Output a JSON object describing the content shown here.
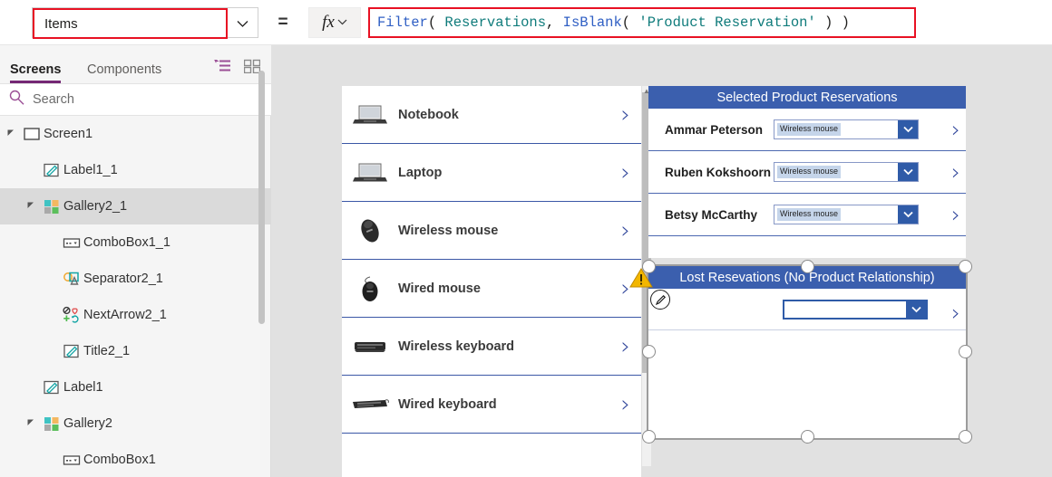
{
  "formula_bar": {
    "property_value": "Items",
    "property_dropdown_icon": "chevron-down-icon",
    "equals": "=",
    "fx_glyph": "fx",
    "fx_chevron_icon": "chevron-down-icon",
    "formula_tokens": [
      {
        "text": "Filter",
        "kind": "fn"
      },
      {
        "text": "( ",
        "kind": "punc"
      },
      {
        "text": "Reservations",
        "kind": "tbl"
      },
      {
        "text": ", ",
        "kind": "punc"
      },
      {
        "text": "IsBlank",
        "kind": "fn"
      },
      {
        "text": "( ",
        "kind": "punc"
      },
      {
        "text": "'Product Reservation'",
        "kind": "str"
      },
      {
        "text": " ) )",
        "kind": "punc"
      }
    ],
    "formula_plain": "Filter( Reservations, IsBlank( 'Product Reservation' ) )",
    "accent_red": "#e81123",
    "fn_color": "#2f5fc4",
    "table_color": "#0f7b7b"
  },
  "sidebar": {
    "tabs": [
      {
        "label": "Screens",
        "active": true
      },
      {
        "label": "Components",
        "active": false
      }
    ],
    "view_icons": [
      {
        "name": "tree-view-icon",
        "color": "#9b4f96"
      },
      {
        "name": "grid-view-icon",
        "color": "#8a8a8a"
      }
    ],
    "search": {
      "placeholder": "Search",
      "value": "",
      "icon": "search-icon"
    },
    "tree": [
      {
        "label": "Screen1",
        "icon": "screen-icon",
        "indent": 0,
        "caret": true,
        "selected": false
      },
      {
        "label": "Label1_1",
        "icon": "label-icon",
        "indent": 1,
        "caret": false,
        "selected": false
      },
      {
        "label": "Gallery2_1",
        "icon": "gallery-icon",
        "indent": 1,
        "caret": true,
        "selected": true
      },
      {
        "label": "ComboBox1_1",
        "icon": "combobox-icon",
        "indent": 2,
        "caret": false,
        "selected": false
      },
      {
        "label": "Separator2_1",
        "icon": "shapes-icon",
        "indent": 2,
        "caret": false,
        "selected": false
      },
      {
        "label": "NextArrow2_1",
        "icon": "icons-icon",
        "indent": 2,
        "caret": false,
        "selected": false
      },
      {
        "label": "Title2_1",
        "icon": "label-icon",
        "indent": 2,
        "caret": false,
        "selected": false
      },
      {
        "label": "Label1",
        "icon": "label-icon",
        "indent": 1,
        "caret": false,
        "selected": false
      },
      {
        "label": "Gallery2",
        "icon": "gallery-icon",
        "indent": 1,
        "caret": true,
        "selected": false
      },
      {
        "label": "ComboBox1",
        "icon": "combobox-icon",
        "indent": 2,
        "caret": false,
        "selected": false
      }
    ]
  },
  "canvas": {
    "product_gallery": {
      "name": "product-gallery",
      "items": [
        {
          "label": "Notebook",
          "thumb": "notebook-photo",
          "chevron": "chevron-right-icon"
        },
        {
          "label": "Laptop",
          "thumb": "laptop-photo",
          "chevron": "chevron-right-icon"
        },
        {
          "label": "Wireless mouse",
          "thumb": "wireless-mouse-photo",
          "chevron": "chevron-right-icon"
        },
        {
          "label": "Wired mouse",
          "thumb": "wired-mouse-photo",
          "chevron": "chevron-right-icon"
        },
        {
          "label": "Wireless keyboard",
          "thumb": "wireless-keyboard-photo",
          "chevron": "chevron-right-icon"
        },
        {
          "label": "Wired keyboard",
          "thumb": "wired-keyboard-photo",
          "chevron": "chevron-right-icon"
        }
      ]
    },
    "selected_reservations": {
      "title": "Selected Product Reservations",
      "rows": [
        {
          "person": "Ammar Peterson",
          "combo_value": "Wireless mouse",
          "chevron": "chevron-right-icon"
        },
        {
          "person": "Ruben Kokshoorn",
          "combo_value": "Wireless mouse",
          "chevron": "chevron-right-icon"
        },
        {
          "person": "Betsy McCarthy",
          "combo_value": "Wireless mouse",
          "chevron": "chevron-right-icon"
        }
      ]
    },
    "lost_reservations": {
      "title": "Lost Resevations (No Product Relationship)",
      "rows": [
        {
          "person": "",
          "combo_value": "",
          "chevron": "chevron-right-icon"
        }
      ],
      "selected": true,
      "edit_badge_icon": "pencil-icon",
      "warning_icon": "warning-triangle-icon"
    },
    "header_blue": "#3b5fae",
    "chevron_blue": "#33489c",
    "background": "#e1e1e1"
  }
}
